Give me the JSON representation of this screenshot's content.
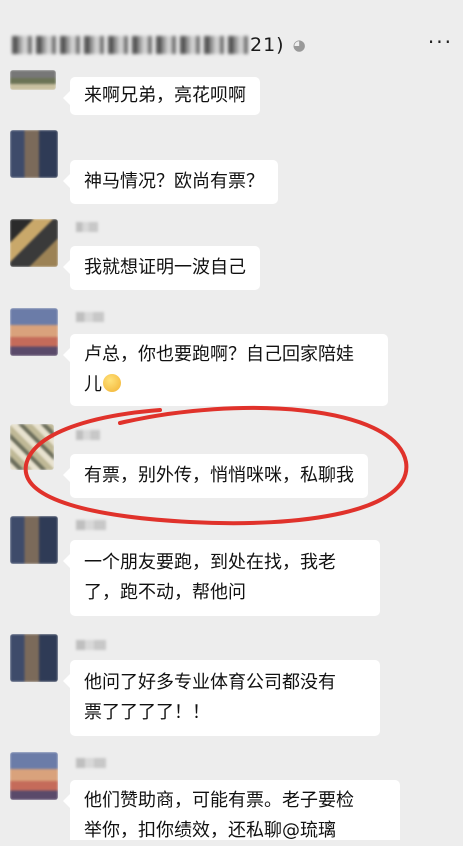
{
  "header": {
    "title_suffix": "21)",
    "ear_icon": "earpiece-icon",
    "more_label": "···"
  },
  "messages": [
    {
      "text": "来啊兄弟，亮花呗啊"
    },
    {
      "text": "神马情况？欧尚有票？"
    },
    {
      "text": "我就想证明一波自己"
    },
    {
      "text": "卢总，你也要跑啊？自己回家陪娃",
      "text2": "儿",
      "emoji": "smile-emoji"
    },
    {
      "text": "有票，别外传，悄悄咪咪，私聊我"
    },
    {
      "text": "一个朋友要跑，到处在找，我老",
      "text2": "了，跑不动，帮他问"
    },
    {
      "text": "他问了好多专业体育公司都没有",
      "text2": "票了了了了！！"
    },
    {
      "text": "他们赞助商，可能有票。老子要检",
      "text2": "举你，扣你绩效，还私聊@琉璃"
    }
  ],
  "colors": {
    "background": "#ededed",
    "bubble": "#ffffff",
    "highlight_circle": "#e0322b"
  }
}
